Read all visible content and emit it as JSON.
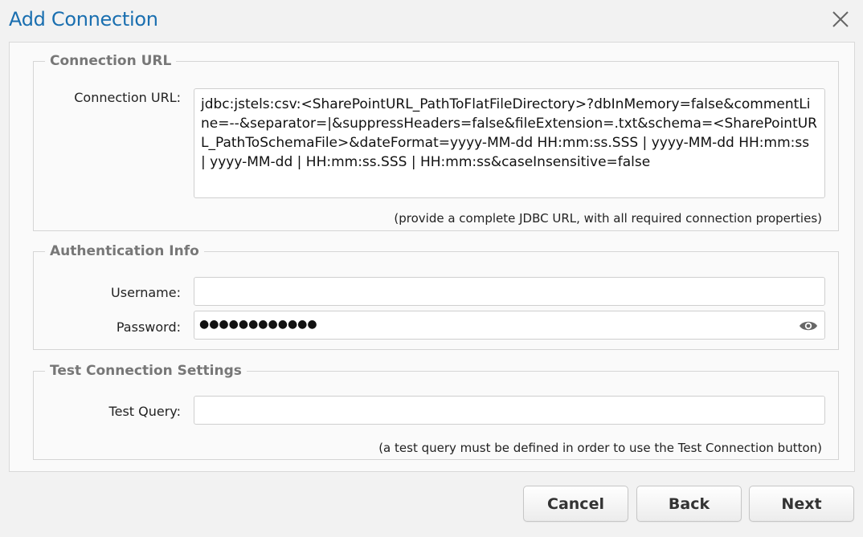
{
  "dialog": {
    "title": "Add Connection",
    "close_icon": "close-icon"
  },
  "connection_url_section": {
    "legend": "Connection URL",
    "label": "Connection URL:",
    "value": "jdbc:jstels:csv:<SharePointURL_PathToFlatFileDirectory>?dbInMemory=false&commentLine=--&separator=|&suppressHeaders=false&fileExtension=.txt&schema=<SharePointURL_PathToSchemaFile>&dateFormat=yyyy-MM-dd HH:mm:ss.SSS | yyyy-MM-dd HH:mm:ss | yyyy-MM-dd | HH:mm:ss.SSS | HH:mm:ss&caseInsensitive=false",
    "hint": "(provide a complete JDBC URL, with all required connection properties)"
  },
  "auth_section": {
    "legend": "Authentication Info",
    "username_label": "Username:",
    "username_value": "",
    "password_label": "Password:",
    "password_mask": "●●●●●●●●●●●●",
    "password_icon": "eye-icon"
  },
  "test_section": {
    "legend": "Test Connection Settings",
    "query_label": "Test Query:",
    "query_value": "",
    "hint": "(a test query must be defined in order to use the Test Connection button)"
  },
  "buttons": {
    "cancel": "Cancel",
    "back": "Back",
    "next": "Next"
  },
  "colors": {
    "title": "#1a6fb0",
    "legend": "#777777"
  }
}
